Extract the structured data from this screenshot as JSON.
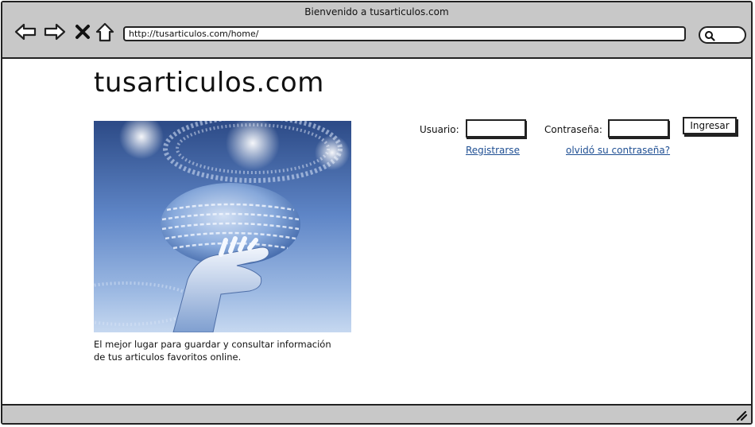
{
  "window": {
    "title": "Bienvenido a tusarticulos.com"
  },
  "toolbar": {
    "back_icon": "arrow-left-icon",
    "forward_icon": "arrow-right-icon",
    "stop_icon": "close-icon",
    "home_icon": "home-icon",
    "search_icon": "magnifier-icon",
    "url": "http://tusarticulos.com/home/"
  },
  "page": {
    "logo": "tusarticulos.com",
    "hero_image": "hand-holding-digital-globe",
    "tagline_line1": "El mejor lugar para guardar y consultar información",
    "tagline_line2": "de tus articulos favoritos online."
  },
  "login": {
    "user_label": "Usuario:",
    "user_value": "",
    "password_label": "Contraseña:",
    "password_value": "",
    "submit_label": "Ingresar",
    "register_link": "Registrarse",
    "forgot_link": "olvidó su contraseña?"
  },
  "colors": {
    "chrome": "#c8c8c8",
    "link": "#1f4f93",
    "border": "#222222"
  }
}
